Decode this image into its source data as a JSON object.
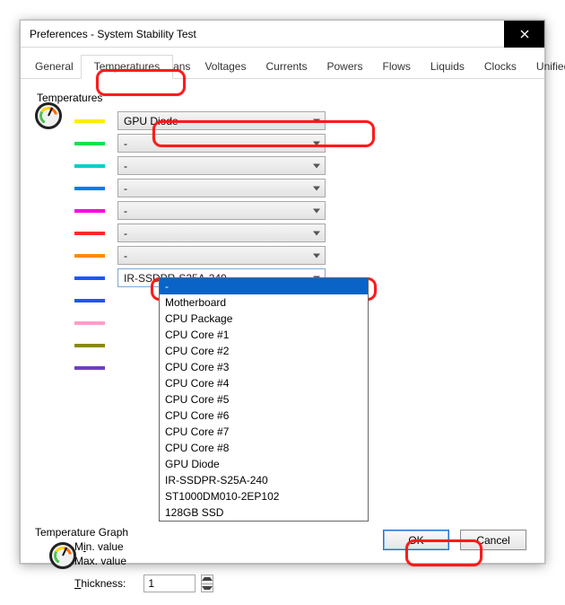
{
  "window": {
    "title": "Preferences - System Stability Test"
  },
  "tabs": [
    "General",
    "Temperatures",
    "Cooling Fans",
    "Voltages",
    "Currents",
    "Powers",
    "Flows",
    "Liquids",
    "Clocks",
    "Unified"
  ],
  "active_tab_index": 1,
  "group": {
    "title": "Temperatures",
    "swatch_colors": [
      "#ffee00",
      "#00e64d",
      "#00d0c6",
      "#0078ff",
      "#ff00e1",
      "#ff2a2a",
      "#ff8a00",
      "#1e55ff",
      "#1e55ff",
      "#ff9ec6",
      "#8a8a00",
      "#6e3fbf"
    ],
    "combos": [
      "GPU Diode",
      "-",
      "-",
      "-",
      "-",
      "-",
      "-",
      "IR-SSDPR-S25A-240"
    ]
  },
  "dropdown": {
    "selected": "-",
    "options": [
      "-",
      "Motherboard",
      "CPU Package",
      "CPU Core #1",
      "CPU Core #2",
      "CPU Core #3",
      "CPU Core #4",
      "CPU Core #5",
      "CPU Core #6",
      "CPU Core #7",
      "CPU Core #8",
      "GPU Diode",
      "IR-SSDPR-S25A-240",
      "ST1000DM010-2EP102",
      "128GB SSD"
    ]
  },
  "graph": {
    "section_label": "Temperature Graph",
    "min_label_pre": "M",
    "min_label_u": "i",
    "min_label_post": "n. value",
    "max_label": "Max. value",
    "thickness_label_pre": "T",
    "thickness_label_u": "h",
    "thickness_label_post": "ickness:",
    "thickness_value": "1"
  },
  "buttons": {
    "ok": "OK",
    "cancel": "Cancel"
  }
}
